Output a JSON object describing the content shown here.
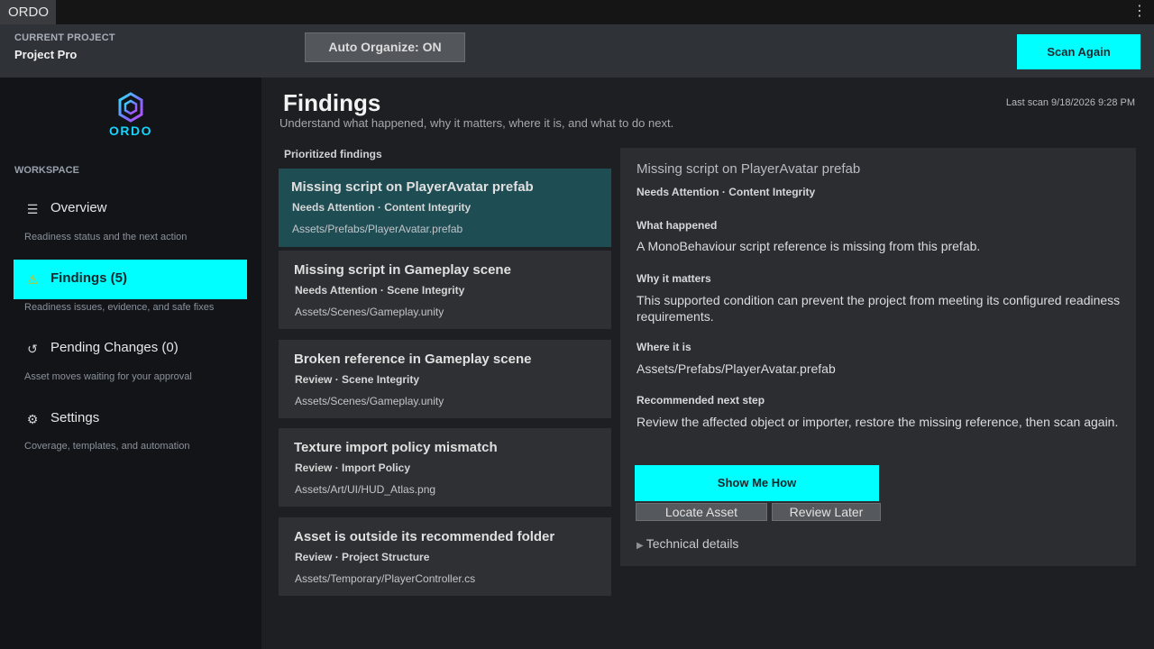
{
  "titlebar": {
    "tab": "ORDO",
    "menu_icon": "⋮"
  },
  "header": {
    "project_label": "CURRENT PROJECT",
    "project_name": "Project Pro",
    "auto_organize": "Auto Organize: ON",
    "scan_again": "Scan Again"
  },
  "sidebar": {
    "logo_text": "ORDO",
    "section_label": "WORKSPACE",
    "items": [
      {
        "label": "Overview",
        "desc": "Readiness status and the next action",
        "icon": "list-icon",
        "glyph": "☰"
      },
      {
        "label": "Findings (5)",
        "desc": "Readiness issues, evidence, and safe fixes",
        "icon": "warning-icon",
        "glyph": "⚠"
      },
      {
        "label": "Pending Changes (0)",
        "desc": "Asset moves waiting for your approval",
        "icon": "history-icon",
        "glyph": "↺"
      },
      {
        "label": "Settings",
        "desc": "Coverage, templates, and automation",
        "icon": "gear-icon",
        "glyph": "⚙"
      }
    ]
  },
  "main": {
    "title": "Findings",
    "subtitle": "Understand what happened, why it matters, where it is, and what to do next.",
    "last_scan": "Last scan 9/18/2026 9:28 PM",
    "list_label": "Prioritized findings",
    "findings": [
      {
        "title": "Missing script on PlayerAvatar prefab",
        "meta": "Needs Attention · Content Integrity",
        "path": "Assets/Prefabs/PlayerAvatar.prefab"
      },
      {
        "title": "Missing script in Gameplay scene",
        "meta": "Needs Attention · Scene Integrity",
        "path": "Assets/Scenes/Gameplay.unity"
      },
      {
        "title": "Broken reference in Gameplay scene",
        "meta": "Review · Scene Integrity",
        "path": "Assets/Scenes/Gameplay.unity"
      },
      {
        "title": "Texture import policy mismatch",
        "meta": "Review · Import Policy",
        "path": "Assets/Art/UI/HUD_Atlas.png"
      },
      {
        "title": "Asset is outside its recommended folder",
        "meta": "Review · Project Structure",
        "path": "Assets/Temporary/PlayerController.cs"
      }
    ]
  },
  "detail": {
    "title": "Missing script on PlayerAvatar prefab",
    "meta": "Needs Attention · Content Integrity",
    "what_happened_label": "What happened",
    "what_happened": "A MonoBehaviour script reference is missing from this prefab.",
    "why_label": "Why it matters",
    "why": "This supported condition can prevent the project from meeting its configured readiness requirements.",
    "where_label": "Where it is",
    "where": "Assets/Prefabs/PlayerAvatar.prefab",
    "next_label": "Recommended next step",
    "next": "Review the affected object or importer, restore the missing reference, then scan again.",
    "show_me_how": "Show Me How",
    "locate_asset": "Locate Asset",
    "review_later": "Review Later",
    "technical_details": "Technical details"
  },
  "colors": {
    "accent": "#00ffff",
    "selected_row": "#1f4d54",
    "logo": "#17d4ff"
  }
}
